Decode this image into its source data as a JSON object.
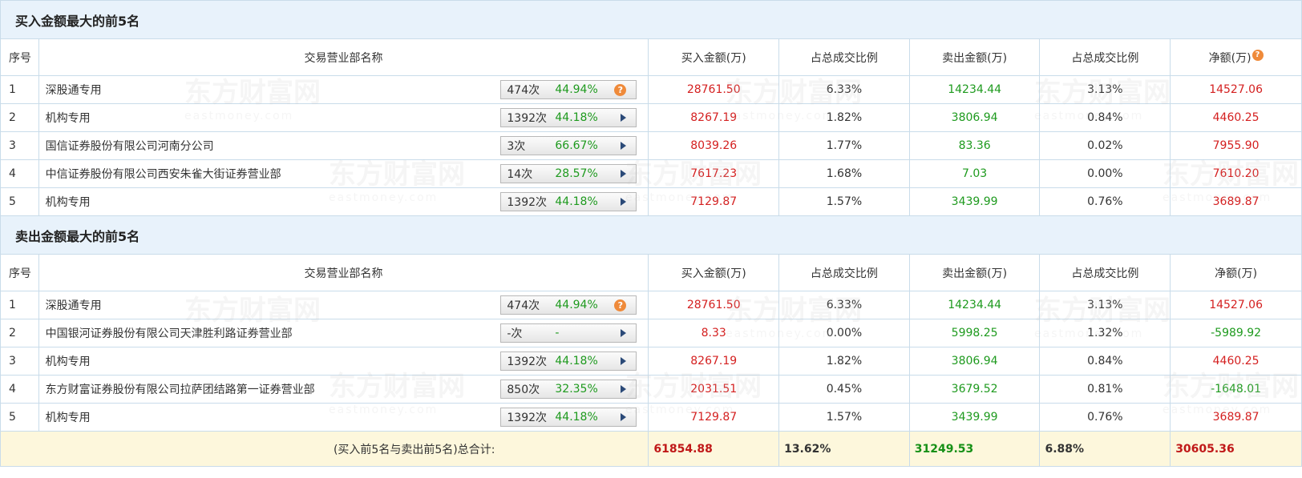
{
  "buy_section": {
    "title": "买入金额最大的前5名",
    "headers": {
      "idx": "序号",
      "name": "交易营业部名称",
      "buy": "买入金额(万)",
      "buy_pct": "占总成交比例",
      "sell": "卖出金额(万)",
      "sell_pct": "占总成交比例",
      "net": "净额(万)"
    },
    "rows": [
      {
        "idx": "1",
        "name": "深股通专用",
        "count": "474次",
        "rate": "44.94%",
        "pill_icon": "help-icon",
        "buy": "28761.50",
        "buy_pct": "6.33%",
        "sell": "14234.44",
        "sell_pct": "3.13%",
        "net": "14527.06"
      },
      {
        "idx": "2",
        "name": "机构专用",
        "count": "1392次",
        "rate": "44.18%",
        "pill_icon": "play-arrow-icon",
        "buy": "8267.19",
        "buy_pct": "1.82%",
        "sell": "3806.94",
        "sell_pct": "0.84%",
        "net": "4460.25"
      },
      {
        "idx": "3",
        "name": "国信证券股份有限公司河南分公司",
        "count": "3次",
        "rate": "66.67%",
        "pill_icon": "play-arrow-icon",
        "buy": "8039.26",
        "buy_pct": "1.77%",
        "sell": "83.36",
        "sell_pct": "0.02%",
        "net": "7955.90"
      },
      {
        "idx": "4",
        "name": "中信证券股份有限公司西安朱雀大街证券营业部",
        "count": "14次",
        "rate": "28.57%",
        "pill_icon": "play-arrow-icon",
        "buy": "7617.23",
        "buy_pct": "1.68%",
        "sell": "7.03",
        "sell_pct": "0.00%",
        "net": "7610.20"
      },
      {
        "idx": "5",
        "name": "机构专用",
        "count": "1392次",
        "rate": "44.18%",
        "pill_icon": "play-arrow-icon",
        "buy": "7129.87",
        "buy_pct": "1.57%",
        "sell": "3439.99",
        "sell_pct": "0.76%",
        "net": "3689.87"
      }
    ]
  },
  "sell_section": {
    "title": "卖出金额最大的前5名",
    "headers": {
      "idx": "序号",
      "name": "交易营业部名称",
      "buy": "买入金额(万)",
      "buy_pct": "占总成交比例",
      "sell": "卖出金额(万)",
      "sell_pct": "占总成交比例",
      "net": "净额(万)"
    },
    "rows": [
      {
        "idx": "1",
        "name": "深股通专用",
        "count": "474次",
        "rate": "44.94%",
        "pill_icon": "help-icon",
        "buy": "28761.50",
        "buy_pct": "6.33%",
        "sell": "14234.44",
        "sell_pct": "3.13%",
        "net": "14527.06"
      },
      {
        "idx": "2",
        "name": "中国银河证券股份有限公司天津胜利路证券营业部",
        "count": "-次",
        "rate": "-",
        "pill_icon": "play-arrow-icon",
        "buy": "8.33",
        "buy_pct": "0.00%",
        "sell": "5998.25",
        "sell_pct": "1.32%",
        "net": "-5989.92"
      },
      {
        "idx": "3",
        "name": "机构专用",
        "count": "1392次",
        "rate": "44.18%",
        "pill_icon": "play-arrow-icon",
        "buy": "8267.19",
        "buy_pct": "1.82%",
        "sell": "3806.94",
        "sell_pct": "0.84%",
        "net": "4460.25"
      },
      {
        "idx": "4",
        "name": "东方财富证券股份有限公司拉萨团结路第一证券营业部",
        "count": "850次",
        "rate": "32.35%",
        "pill_icon": "play-arrow-icon",
        "buy": "2031.51",
        "buy_pct": "0.45%",
        "sell": "3679.52",
        "sell_pct": "0.81%",
        "net": "-1648.01"
      },
      {
        "idx": "5",
        "name": "机构专用",
        "count": "1392次",
        "rate": "44.18%",
        "pill_icon": "play-arrow-icon",
        "buy": "7129.87",
        "buy_pct": "1.57%",
        "sell": "3439.99",
        "sell_pct": "0.76%",
        "net": "3689.87"
      }
    ]
  },
  "total": {
    "label": "(买入前5名与卖出前5名)总合计:",
    "buy": "61854.88",
    "buy_pct": "13.62%",
    "sell": "31249.53",
    "sell_pct": "6.88%",
    "net": "30605.36"
  },
  "help_glyph": "?",
  "watermark": {
    "cn": "东方财富网",
    "en": "eastmoney.com"
  },
  "colors": {
    "buy": "#d42020",
    "sell": "#1e9a1e",
    "header_bg": "#e8f2fb",
    "total_bg": "#fdf7dc",
    "help_icon": "#ef8a3a",
    "arrow": "#2b4a78"
  }
}
